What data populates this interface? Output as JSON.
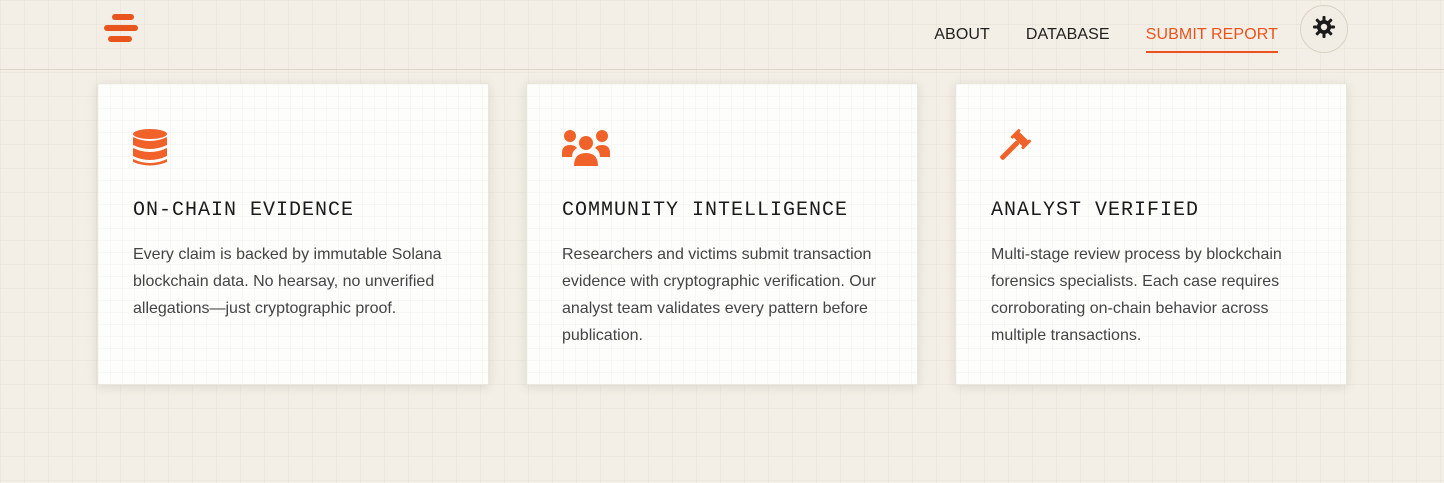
{
  "brand": {
    "logo_icon": "stacked-bars-logo-icon",
    "accent": "#e8541c"
  },
  "nav": {
    "items": [
      {
        "label": "ABOUT"
      },
      {
        "label": "DATABASE"
      },
      {
        "label": "SUBMIT REPORT",
        "active": true
      }
    ],
    "theme_toggle_icon": "gear-icon"
  },
  "features": [
    {
      "icon": "database-icon",
      "title": "ON-CHAIN EVIDENCE",
      "text": "Every claim is backed by immutable Solana blockchain data. No hearsay, no unverified allegations—just cryptographic proof."
    },
    {
      "icon": "users-group-icon",
      "title": "COMMUNITY INTELLIGENCE",
      "text": "Researchers and victims submit transaction evidence with cryptographic verification. Our analyst team validates every pattern before publication."
    },
    {
      "icon": "gavel-icon",
      "title": "ANALYST VERIFIED",
      "text": "Multi-stage review process by blockchain forensics specialists. Each case requires corroborating on-chain behavior across multiple transactions."
    }
  ]
}
